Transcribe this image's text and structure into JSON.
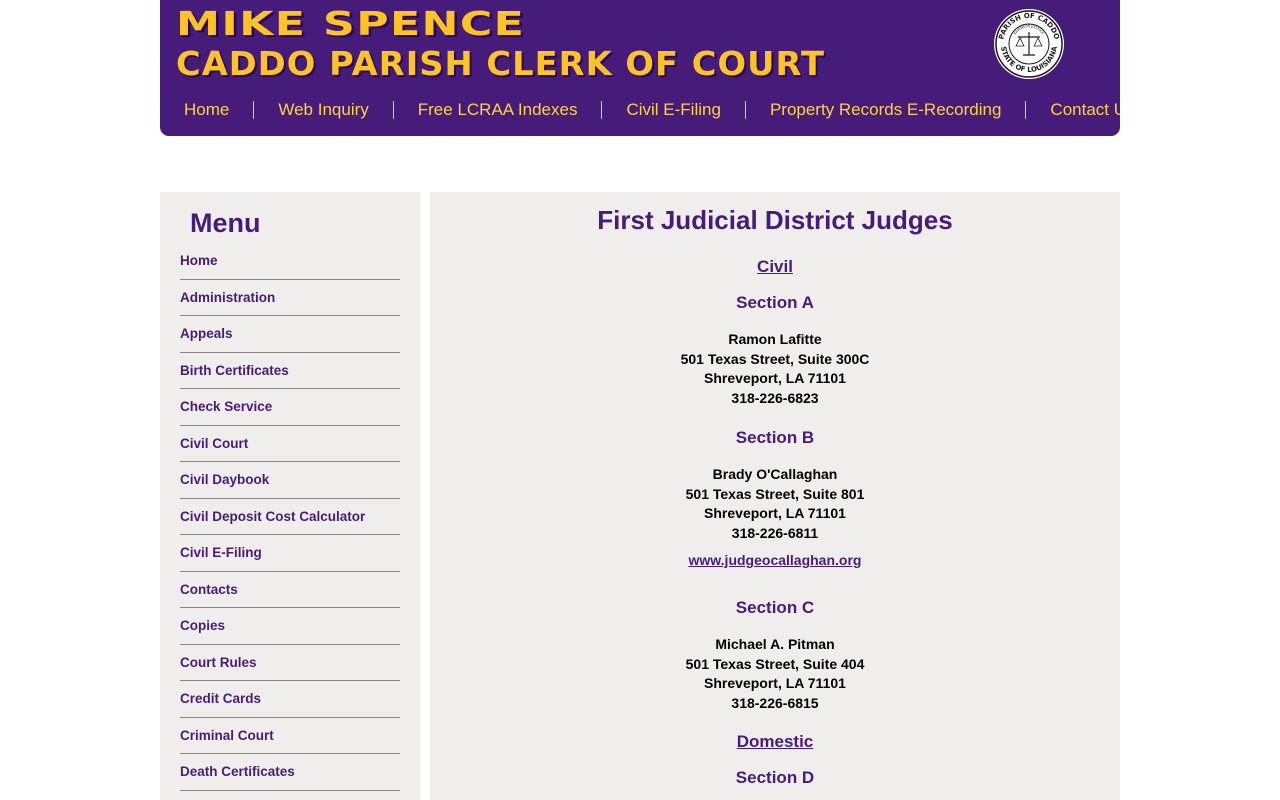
{
  "header": {
    "title_line1": "MIKE SPENCE",
    "title_line2": "CADDO PARISH CLERK OF COURT",
    "seal": {
      "outer_text_top": "PARISH OF CADDO",
      "outer_text_bottom": "STATE OF LOUISIANA",
      "inner_text_top": "FAIRNESS JUSTICE",
      "inner_text_bottom": "CONFIDENCE"
    },
    "nav": [
      "Home",
      "Web Inquiry",
      "Free LCRAA Indexes",
      "Civil E-Filing",
      "Property Records E-Recording",
      "Contact Us"
    ]
  },
  "sidebar": {
    "heading": "Menu",
    "items": [
      "Home",
      "Administration",
      "Appeals",
      "Birth Certificates",
      "Check Service",
      "Civil Court",
      "Civil Daybook",
      "Civil Deposit Cost Calculator",
      "Civil E-Filing",
      "Contacts",
      "Copies",
      "Court Rules",
      "Credit Cards",
      "Criminal Court",
      "Death Certificates"
    ]
  },
  "main": {
    "title": "First Judicial District Judges",
    "categories": [
      "Civil",
      "Domestic"
    ],
    "sections": [
      {
        "label": "Section A",
        "name": "Ramon Lafitte",
        "address": "501 Texas Street, Suite 300C",
        "city": "Shreveport, LA 71101",
        "phone": "318-226-6823"
      },
      {
        "label": "Section B",
        "name": "Brady O'Callaghan",
        "address": "501 Texas Street, Suite 801",
        "city": "Shreveport, LA 71101",
        "phone": "318-226-6811",
        "website": "www.judgeocallaghan.org"
      },
      {
        "label": "Section C",
        "name": "Michael A. Pitman",
        "address": "501 Texas Street, Suite 404",
        "city": "Shreveport, LA 71101",
        "phone": "318-226-6815"
      },
      {
        "label": "Section D"
      }
    ]
  },
  "colors": {
    "brand_purple": "#461c7a",
    "brand_gold": "#ffc423",
    "panel_bg": "#f0eeed"
  }
}
